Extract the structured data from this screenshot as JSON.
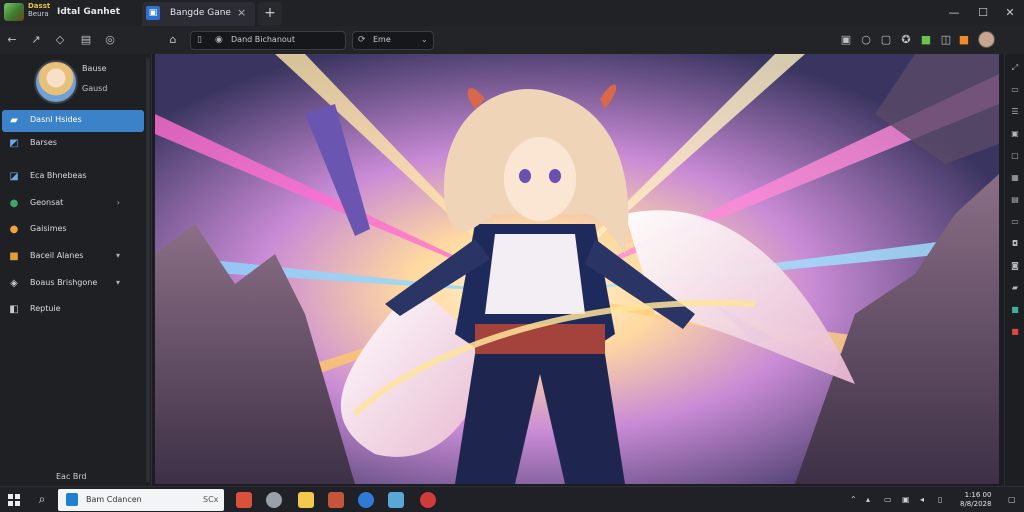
{
  "app": {
    "brand_line1": "Dasst",
    "brand_line2": "Beura",
    "title": "Idtal Ganhet"
  },
  "tabs": [
    {
      "label": "Bangde Gane",
      "close": "×"
    }
  ],
  "new_tab": "+",
  "window": {
    "minimize": "—",
    "maximize": "☐",
    "close": "✕"
  },
  "toolbar": {
    "address_text": "Dand Bichanout",
    "dropdown_text": "Eme"
  },
  "user": {
    "name": "Bause",
    "sub": "Gausd"
  },
  "nav": [
    {
      "label": "Dasnl Hsides",
      "active": true,
      "icon": "folder-icon"
    },
    {
      "label": "Barses",
      "icon": "image-icon"
    },
    {
      "label": "Eca Bhnebeas",
      "icon": "pen-icon"
    },
    {
      "label": "Geonsat",
      "icon": "circle-icon",
      "chevron": "›"
    },
    {
      "label": "Gaisimes",
      "icon": "gear-icon"
    },
    {
      "label": "Baceil Alanes",
      "icon": "box-icon",
      "chevron": "▾"
    },
    {
      "label": "Boaus Brishgone",
      "icon": "puzzle-icon",
      "chevron": "▾"
    },
    {
      "label": "Reptuie",
      "icon": "wrench-icon"
    }
  ],
  "sidebar_footer": "Eac Brd",
  "taskbar": {
    "search_text": "Bam Cdancen",
    "search_right": "SCx",
    "clock_time": "1:16 00",
    "clock_date": "8/8/2028"
  },
  "colors": {
    "accent": "#3c82c9",
    "background": "#1b1d22"
  }
}
